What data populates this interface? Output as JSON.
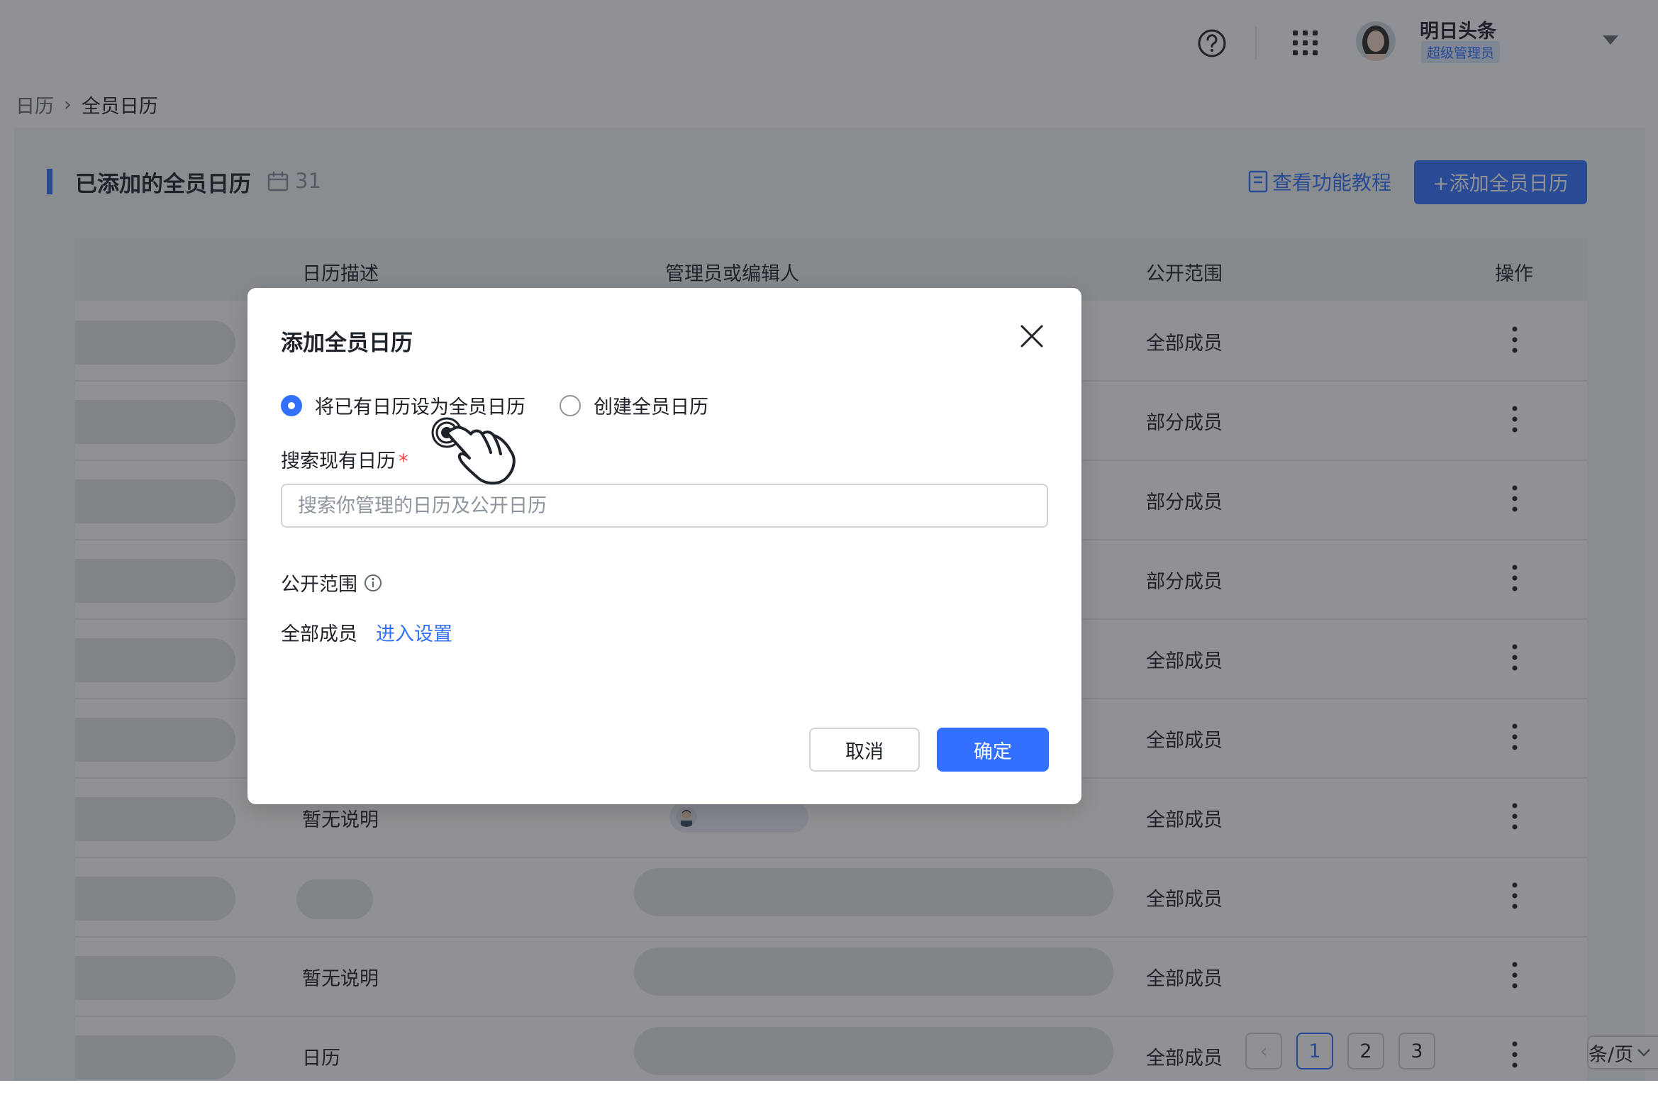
{
  "header": {
    "user_name": "明日头条",
    "user_role": "超级管理员",
    "icons": [
      "help-icon",
      "apps-icon",
      "avatar",
      "chevron-down-icon"
    ]
  },
  "breadcrumb": {
    "parent": "日历",
    "separator": "›",
    "current": "全员日历"
  },
  "section": {
    "title": "已添加的全员日历",
    "count": "31",
    "tutorial_label": "查看功能教程",
    "add_button_label": "+添加全员日历"
  },
  "table": {
    "columns": {
      "desc": "日历描述",
      "admins": "管理员或编辑人",
      "scope": "公开范围",
      "actions": "操作"
    },
    "rows": [
      {
        "desc": "",
        "scope": "全部成员"
      },
      {
        "desc": "",
        "scope": "部分成员"
      },
      {
        "desc": "",
        "scope": "部分成员"
      },
      {
        "desc": "",
        "scope": "部分成员"
      },
      {
        "desc": "",
        "scope": "全部成员"
      },
      {
        "desc": "",
        "scope": "全部成员"
      },
      {
        "desc": "暂无说明",
        "scope": "全部成员"
      },
      {
        "desc": "",
        "scope": "全部成员"
      },
      {
        "desc": "暂无说明",
        "scope": "全部成员"
      },
      {
        "desc": "日历",
        "scope": "全部成员"
      }
    ]
  },
  "pagination": {
    "prev": "‹",
    "pages": [
      "1",
      "2",
      "3"
    ],
    "active": "1",
    "page_size_suffix": "条/页"
  },
  "dialog": {
    "title": "添加全员日历",
    "option_existing": "将已有日历设为全员日历",
    "option_create": "创建全员日历",
    "selected_option": "option_existing",
    "search_label": "搜索现有日历",
    "required_mark": "*",
    "search_placeholder": "搜索你管理的日历及公开日历",
    "search_value": "",
    "scope_label": "公开范围",
    "scope_value": "全部成员",
    "scope_link": "进入设置",
    "cancel_label": "取消",
    "ok_label": "确定"
  },
  "colors": {
    "accent": "#3370ff",
    "required": "#f54a45",
    "overlay": "rgba(31,35,41,0.5)"
  }
}
